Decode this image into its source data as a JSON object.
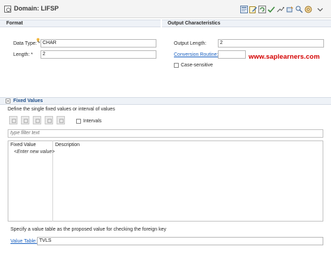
{
  "header": {
    "title": "Domain: LIFSP"
  },
  "toolbar": {
    "icons": [
      "activate-icon",
      "edit-icon",
      "refresh-icon",
      "check-icon",
      "where-used-icon",
      "transport-icon",
      "display-icon"
    ]
  },
  "format": {
    "section_label": "Format",
    "data_type_label": "Data Type: *",
    "data_type_value": "CHAR",
    "length_label": "Length: *",
    "length_value": "2"
  },
  "output": {
    "section_label": "Output Characteristics",
    "output_length_label": "Output Length:",
    "output_length_value": "2",
    "conversion_routine_label": "Conversion Routine:",
    "conversion_routine_value": "",
    "case_sensitive_label": "Case-sensitive",
    "case_sensitive_checked": false
  },
  "watermark": "www.saplearners.com",
  "fixed_values": {
    "section_label": "Fixed Values",
    "description": "Define the single fixed values or interval of values",
    "intervals_label": "Intervals",
    "intervals_checked": false,
    "filter_placeholder": "type filter text",
    "columns": [
      "Fixed Value",
      "Description"
    ],
    "new_row_text": "<Enter new value>"
  },
  "value_table": {
    "hint": "Specify a value table as the proposed value for checking the foreign key",
    "label": "Value Table:",
    "value": "TVLS"
  },
  "colors": {
    "link": "#1d63c2",
    "watermark": "#d40000",
    "section_header_bg": "#eef2f7"
  }
}
